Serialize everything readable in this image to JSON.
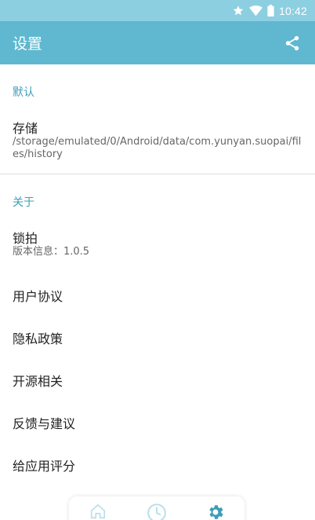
{
  "status_bar": {
    "time": "10:42",
    "icons": [
      "star-icon",
      "wifi-icon",
      "battery-icon"
    ]
  },
  "app_bar": {
    "title": "设置",
    "share_icon": "share-icon"
  },
  "sections": {
    "default": {
      "header": "默认",
      "storage": {
        "title": "存储",
        "path": "/storage/emulated/0/Android/data/com.yunyan.suopai/files/history"
      }
    },
    "about": {
      "header": "关于",
      "app": {
        "title": "锁拍",
        "version": "版本信息：1.0.5"
      },
      "user_agreement": "用户协议",
      "privacy_policy": "隐私政策",
      "open_source": "开源相关",
      "feedback": "反馈与建议",
      "rate_app": "给应用评分"
    }
  },
  "bottom_nav": {
    "items": [
      "home-icon",
      "history-clock-icon",
      "settings-gear-icon"
    ],
    "active": "settings-gear-icon"
  },
  "colors": {
    "status_bar": "#8ccfe0",
    "app_bar": "#5fb8cf",
    "accent": "#3e9db7",
    "nav_inactive": "#b8dfe9",
    "nav_active": "#3e9db7"
  }
}
